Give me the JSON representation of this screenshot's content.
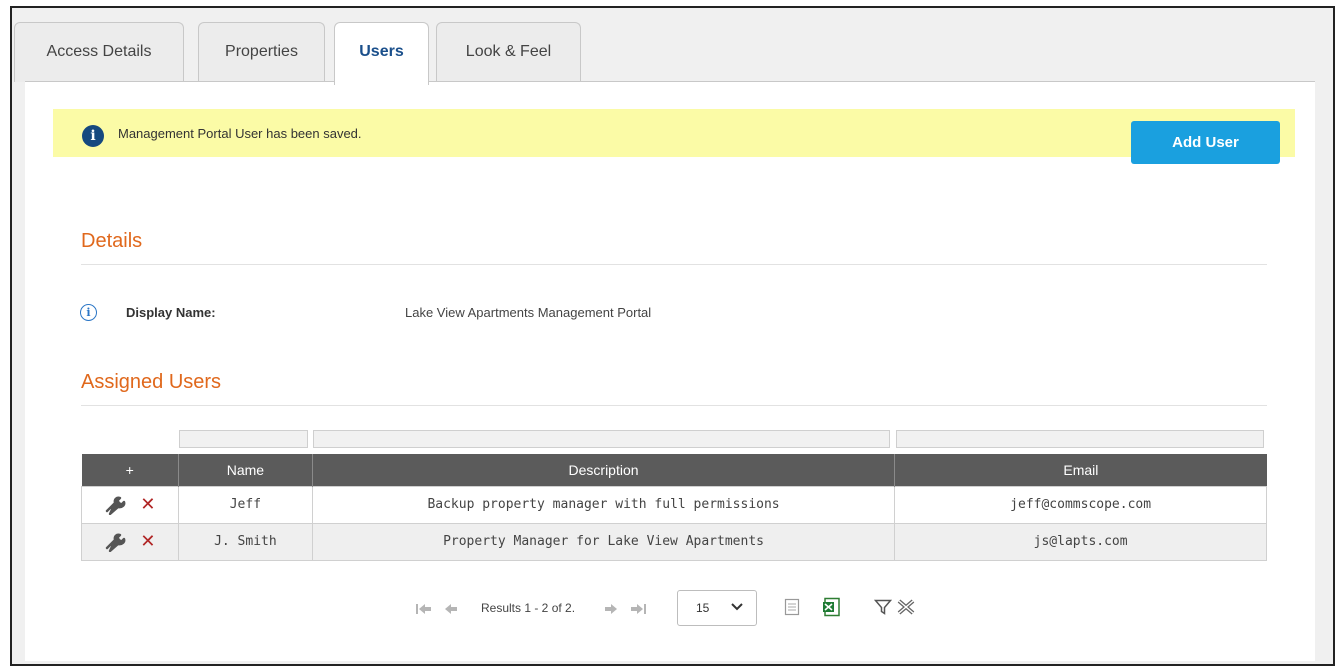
{
  "tabs": [
    {
      "label": "Access Details",
      "active": false
    },
    {
      "label": "Properties",
      "active": false
    },
    {
      "label": "Users",
      "active": true
    },
    {
      "label": "Look & Feel",
      "active": false
    }
  ],
  "notice": {
    "text": "Management Portal User has been saved.",
    "icon": "info-icon",
    "background": "#fbfba6"
  },
  "add_user_label": "Add User",
  "details": {
    "title": "Details",
    "display_name_label": "Display Name:",
    "display_name_value": "Lake View Apartments Management Portal"
  },
  "assigned_users": {
    "title": "Assigned Users",
    "columns": {
      "actions": "+",
      "name": "Name",
      "description": "Description",
      "email": "Email"
    },
    "rows": [
      {
        "name": "Jeff",
        "description": "Backup property manager with full permissions",
        "email": "jeff@commscope.com"
      },
      {
        "name": "J. Smith",
        "description": "Property Manager for Lake View Apartments",
        "email": "js@lapts.com"
      }
    ]
  },
  "pager": {
    "results": "Results 1 - 2 of 2.",
    "page_size": "15"
  },
  "colors": {
    "accent": "#1aa0df",
    "section_title": "#e0681c",
    "active_tab": "#1a4f8b",
    "table_header": "#5b5b5b",
    "delete_icon": "#b02525"
  }
}
